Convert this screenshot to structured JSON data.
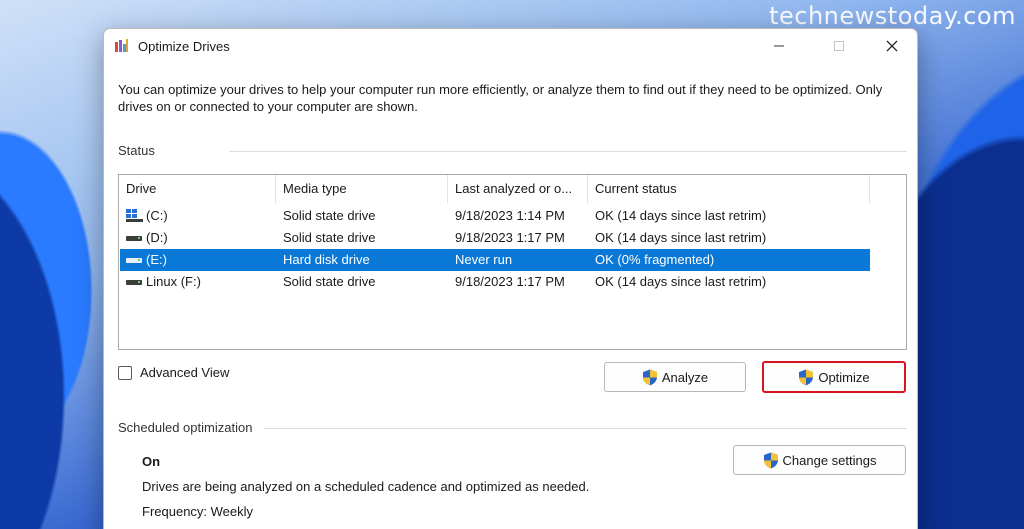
{
  "watermark": "technewstoday.com",
  "window": {
    "title": "Optimize Drives",
    "icon": "defrag-icon",
    "controls": [
      "minimize-icon",
      "maximize-icon",
      "close-icon"
    ]
  },
  "intro": "You can optimize your drives to help your computer run more efficiently, or analyze them to find out if they need to be optimized. Only drives on or connected to your computer are shown.",
  "status": {
    "label": "Status",
    "columns": [
      "Drive",
      "Media type",
      "Last analyzed or o...",
      "Current status"
    ],
    "rows": [
      {
        "drive": "(C:)",
        "icon": "windows-drive-icon",
        "media": "Solid state drive",
        "last": "9/18/2023 1:14 PM",
        "status": "OK (14 days since last retrim)",
        "selected": false
      },
      {
        "drive": "(D:)",
        "icon": "drive-icon",
        "media": "Solid state drive",
        "last": "9/18/2023 1:17 PM",
        "status": "OK (14 days since last retrim)",
        "selected": false
      },
      {
        "drive": "(E:)",
        "icon": "drive-icon",
        "media": "Hard disk drive",
        "last": "Never run",
        "status": "OK (0% fragmented)",
        "selected": true
      },
      {
        "drive": "Linux (F:)",
        "icon": "drive-icon",
        "media": "Solid state drive",
        "last": "9/18/2023 1:17 PM",
        "status": "OK (14 days since last retrim)",
        "selected": false
      }
    ]
  },
  "advanced_view": {
    "label": "Advanced View",
    "checked": false
  },
  "buttons": {
    "analyze": "Analyze",
    "optimize": "Optimize",
    "change_settings": "Change settings"
  },
  "scheduled": {
    "label": "Scheduled optimization",
    "state": "On",
    "description": "Drives are being analyzed on a scheduled cadence and optimized as needed.",
    "frequency": "Frequency: Weekly"
  },
  "colors": {
    "selection": "#0a78d7",
    "highlight_border": "#d8141e"
  }
}
